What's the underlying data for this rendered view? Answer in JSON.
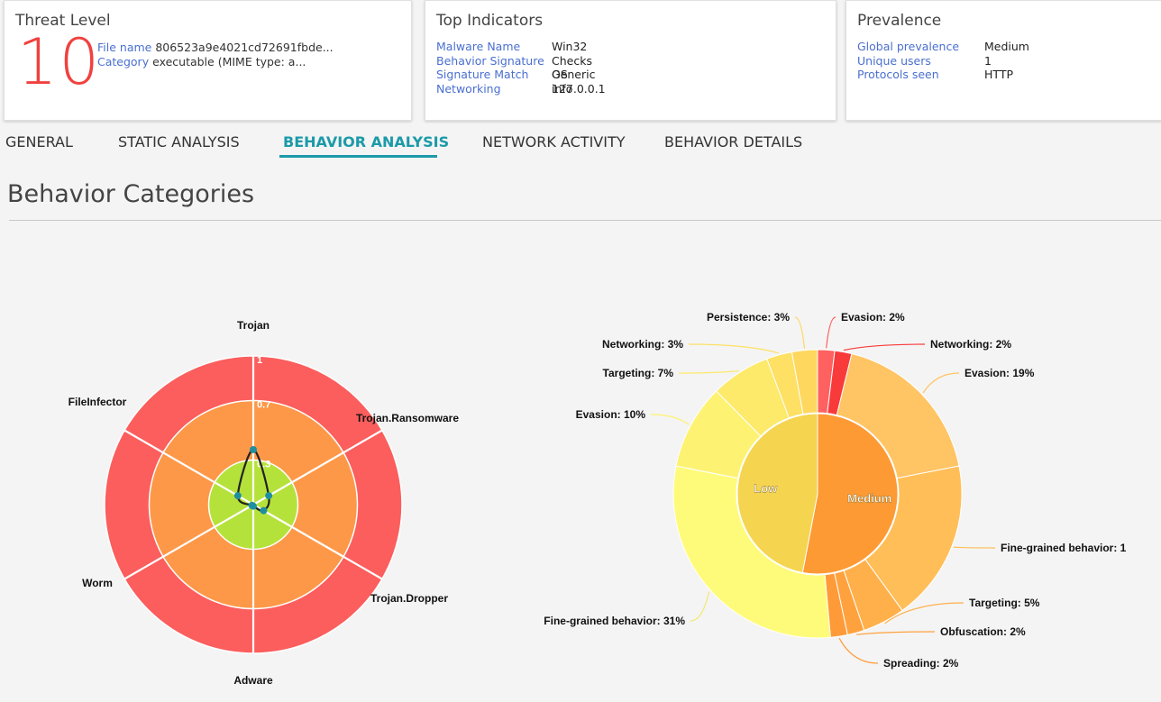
{
  "cards": {
    "threat": {
      "title": "Threat Level",
      "level": "10",
      "file_label": "File name",
      "file_value": "806523a9e4021cd72691fbde...",
      "category_label": "Category",
      "category_value": "executable (MIME type: a..."
    },
    "indicators": {
      "title": "Top Indicators",
      "rows": [
        {
          "label": "Malware Name",
          "value": "Win32"
        },
        {
          "label": "Behavior Signature",
          "value": "Checks OS info"
        },
        {
          "label": "Signature Match",
          "value": "Generic"
        },
        {
          "label": "Networking",
          "value": "127.0.0.1"
        }
      ]
    },
    "prevalence": {
      "title": "Prevalence",
      "rows": [
        {
          "label": "Global prevalence",
          "value": "Medium"
        },
        {
          "label": "Unique users",
          "value": "1"
        },
        {
          "label": "Protocols seen",
          "value": "HTTP"
        }
      ]
    }
  },
  "tabs": [
    {
      "label": "GENERAL",
      "active": false
    },
    {
      "label": "STATIC ANALYSIS",
      "active": false
    },
    {
      "label": "BEHAVIOR ANALYSIS",
      "active": true
    },
    {
      "label": "NETWORK ACTIVITY",
      "active": false
    },
    {
      "label": "BEHAVIOR DETAILS",
      "active": false
    }
  ],
  "section_title": "Behavior Categories",
  "colors": {
    "threat_red": "#f0413f",
    "link_blue": "#4a6fd0",
    "accent_teal": "#1b9aa8",
    "radar_outer": "#fb5e5d",
    "radar_middle": "#fd9848",
    "radar_inner": "#b5e23a",
    "radar_point": "#1f8fa0"
  },
  "chart_data": [
    {
      "type": "radar",
      "axes": [
        "Trojan",
        "Trojan.Ransomware",
        "Trojan.Dropper",
        "Adware",
        "Worm",
        "FileInfector"
      ],
      "values": [
        0.37,
        0.12,
        0.08,
        0.01,
        0.01,
        0.12
      ],
      "ylim": [
        0,
        1
      ],
      "tick_labels": [
        "0.3",
        "0.7",
        "1"
      ],
      "tick_values": [
        0.3,
        0.7,
        1
      ],
      "bands": [
        {
          "range": [
            0,
            0.3
          ],
          "color": "#b5e23a"
        },
        {
          "range": [
            0.3,
            0.7
          ],
          "color": "#fd9848"
        },
        {
          "range": [
            0.7,
            1.0
          ],
          "color": "#fb5e5d"
        }
      ]
    },
    {
      "type": "sunburst",
      "inner": [
        {
          "name": "Medium",
          "value": 53,
          "color": "#fd9a34"
        },
        {
          "name": "Low",
          "value": 47,
          "color": "#f5d450"
        }
      ],
      "outer": [
        {
          "name": "Evasion",
          "value": 2,
          "label": "Evasion: 2%",
          "color": "#ff6060",
          "parent": "Medium"
        },
        {
          "name": "Networking",
          "value": 2,
          "label": "Networking: 2%",
          "color": "#f93a3a",
          "parent": "Medium"
        },
        {
          "name": "Evasion",
          "value": 19,
          "label": "Evasion: 19%",
          "color": "#ffc463",
          "parent": "Medium"
        },
        {
          "name": "Fine-grained behavior",
          "value": 19,
          "label": "Fine-grained behavior: 1",
          "color": "#ffbe58",
          "parent": "Medium"
        },
        {
          "name": "Targeting",
          "value": 5,
          "label": "Targeting: 5%",
          "color": "#ffb04a",
          "parent": "Medium"
        },
        {
          "name": "Obfuscation",
          "value": 2,
          "label": "Obfuscation: 2%",
          "color": "#ffa23e",
          "parent": "Medium"
        },
        {
          "name": "Spreading",
          "value": 2,
          "label": "Spreading: 2%",
          "color": "#ff9a38",
          "parent": "Medium"
        },
        {
          "name": "Fine-grained behavior",
          "value": 31,
          "label": "Fine-grained behavior: 31%",
          "color": "#fffb7a",
          "parent": "Low"
        },
        {
          "name": "Evasion",
          "value": 10,
          "label": "Evasion: 10%",
          "color": "#fef272",
          "parent": "Low"
        },
        {
          "name": "Targeting",
          "value": 7,
          "label": "Targeting: 7%",
          "color": "#fde96a",
          "parent": "Low"
        },
        {
          "name": "Networking",
          "value": 3,
          "label": "Networking: 3%",
          "color": "#fde064",
          "parent": "Low"
        },
        {
          "name": "Persistence",
          "value": 3,
          "label": "Persistence: 3%",
          "color": "#fed75e",
          "parent": "Low"
        }
      ]
    }
  ]
}
